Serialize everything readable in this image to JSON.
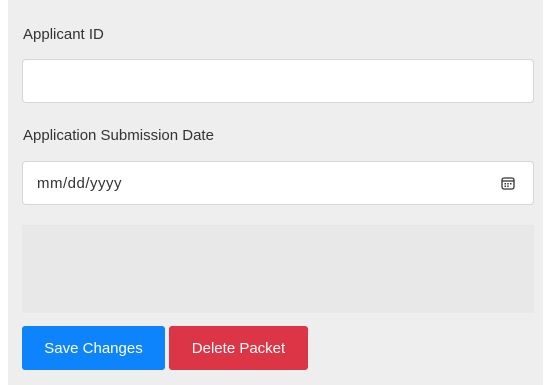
{
  "form": {
    "applicant_id": {
      "label": "Applicant ID",
      "value": "",
      "placeholder": ""
    },
    "submission_date": {
      "label": "Application Submission Date",
      "display": "mm/dd/yyyy",
      "icon": "calendar-icon"
    }
  },
  "actions": {
    "save_label": "Save Changes",
    "delete_label": "Delete Packet"
  },
  "colors": {
    "panel_bg": "#eeeeee",
    "save_button": "#0d84fb",
    "delete_button": "#dc3545"
  }
}
